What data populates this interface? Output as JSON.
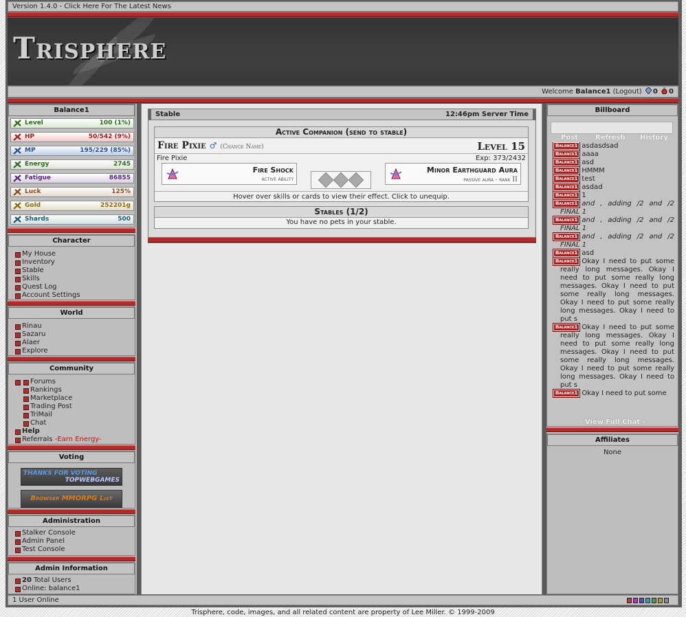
{
  "topbar": {
    "text": "Version 1.4.0 - Click Here For The Latest News"
  },
  "banner": {
    "logo": "Trisphere"
  },
  "welcome": {
    "prefix": "Welcome",
    "user": "Balance1",
    "logout": "(Logout)",
    "crystals": "0",
    "potions": "0"
  },
  "sidebar": {
    "username": "Balance1",
    "stats": [
      {
        "label": "Level",
        "value": "100 (1%)",
        "color": "#2d6a1e",
        "bg": "#d9ead0",
        "icon": "level-icon"
      },
      {
        "label": "HP",
        "value": "50/542 (9%)",
        "color": "#a22020",
        "bg": "#f2c6c6",
        "icon": "heart-icon"
      },
      {
        "label": "MP",
        "value": "195/229 (85%)",
        "color": "#2a4f8e",
        "bg": "#b9cce6",
        "icon": "mana-icon"
      },
      {
        "label": "Energy",
        "value": "2745",
        "color": "#2d6a1e",
        "bg": "#dce3d6",
        "icon": "energy-icon"
      },
      {
        "label": "Fatigue",
        "value": "86855",
        "color": "#5a2a7a",
        "bg": "#d8d0e0",
        "icon": "fatigue-icon"
      },
      {
        "label": "Luck",
        "value": "125%",
        "color": "#8a4a1a",
        "bg": "#e2d9cf",
        "icon": "luck-icon"
      },
      {
        "label": "Gold",
        "value": "252201g",
        "color": "#8a6a10",
        "bg": "#e3ddc8",
        "icon": "gold-icon"
      },
      {
        "label": "Shards",
        "value": "500",
        "color": "#1e5a6a",
        "bg": "#d3e0df",
        "icon": "shards-icon"
      }
    ],
    "character": {
      "title": "Character",
      "items": [
        "My House",
        "Inventory",
        "Stable",
        "Skills",
        "Quest Log",
        "Account Settings"
      ]
    },
    "world": {
      "title": "World",
      "items": [
        "Rinau",
        "Sazaru",
        "Alaer",
        "Explore"
      ]
    },
    "community": {
      "title": "Community",
      "items": [
        "Forums",
        "Rankings",
        "Marketplace",
        "Trading Post",
        "TriMail",
        "Chat"
      ],
      "help": "Help",
      "referrals": "Referrals",
      "earn": "-Earn Energy-"
    },
    "voting": {
      "title": "Voting",
      "btn1_line1": "THANKS FOR VOTING",
      "btn1_line2": "TOPWEBGAMES",
      "btn2": "Browser MMORPG List"
    },
    "admin": {
      "title": "Administration",
      "items": [
        "Stalker Console",
        "Admin Panel",
        "Test Console"
      ]
    },
    "admin_info": {
      "title": "Admin Information",
      "users_count": "20",
      "users_label": "Total Users",
      "online": "Online: balance1"
    }
  },
  "stable": {
    "title": "Stable",
    "server_time": "12:46pm Server Time",
    "active_title": "Active Companion (send to stable)",
    "pet_name": "Fire Pixie",
    "gender": "♂",
    "change_name": "(Change Name)",
    "level": "Level 15",
    "species": "Fire Pixie",
    "exp": "Exp: 373/2432",
    "skill1_name": "Fire Shock",
    "skill1_sub": "active ability",
    "skill2_name": "Minor Earthguard Aura",
    "skill2_sub": "passive aura - rank",
    "skill2_rank": "II",
    "hint": "Hover over skills or cards to view their effect. Click to unequip.",
    "stables_title": "Stables (1/2)",
    "no_pets": "You have no pets in your stable."
  },
  "billboard": {
    "title": "Billboard",
    "post": "Post",
    "refresh": "Refresh",
    "history": "History",
    "tag": "Balance1",
    "messages": [
      "asdasdsad",
      "aaaa",
      "asd",
      "HMMM",
      "test",
      "asdad",
      "1"
    ],
    "italic_msg": "and , adding /2 and /2 FINAL 1",
    "asd": "asd",
    "long_msg": "Okay I need to put some really long messages. Okay I need to put some really long messages. Okay I need to put some really long messages. Okay I need to put some really long messages. Okay I need to put s",
    "last_msg": "Okay I need to put some",
    "view_full": "- View Full Chat -"
  },
  "affiliates": {
    "title": "Affiliates",
    "value": "None"
  },
  "bottombar": {
    "online": "1 User Online"
  },
  "footer": {
    "text": "Trisphere, code, images, and all related content are property of Lee Miller. © 1999-2009"
  },
  "swatches": [
    "#c23a3a",
    "#b03aa8",
    "#5050c8",
    "#3a9ab0",
    "#48a048",
    "#b09a30",
    "#888888"
  ]
}
